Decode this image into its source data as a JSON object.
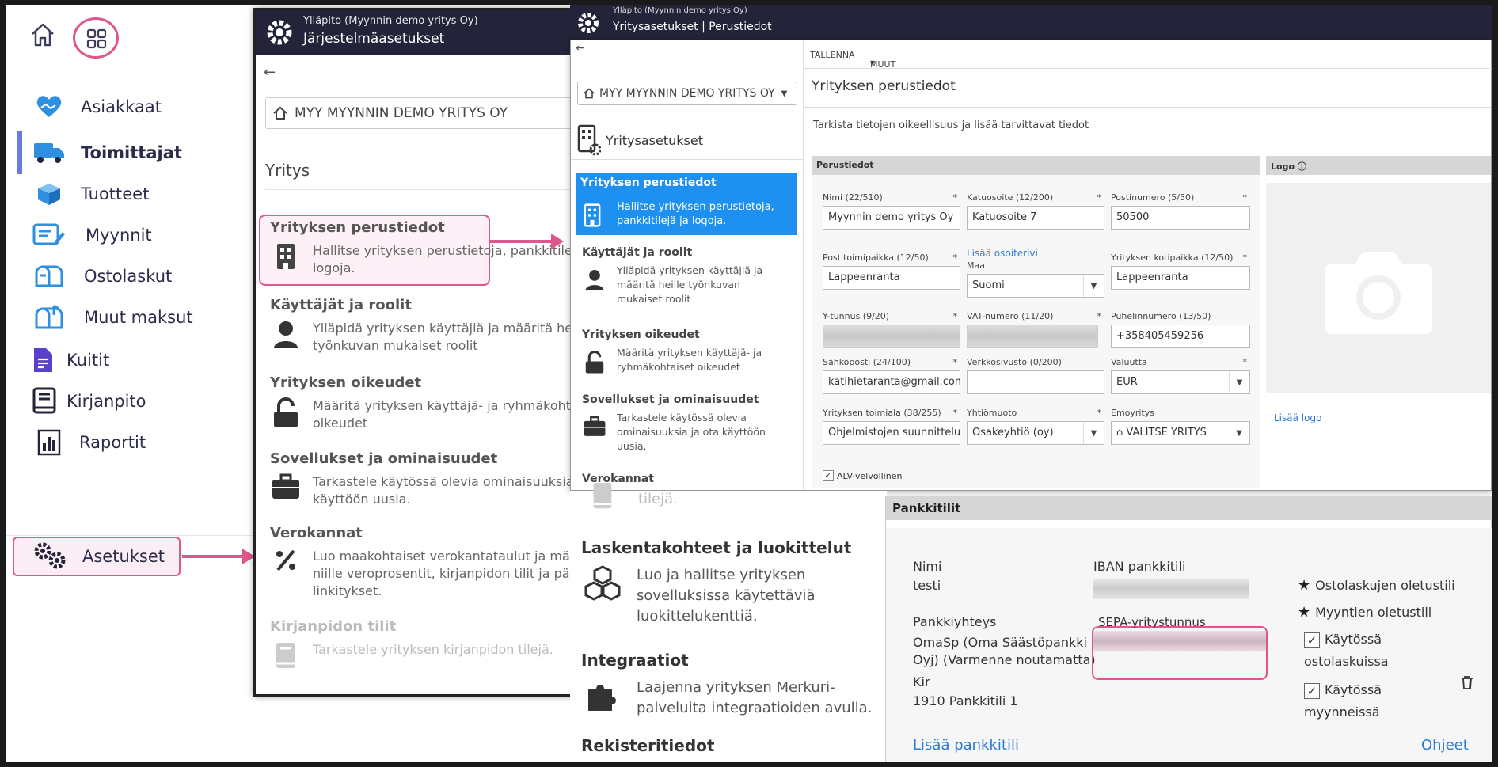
{
  "nav": {
    "items": [
      {
        "label": "Asiakkaat",
        "icon": "handshake-heart-icon"
      },
      {
        "label": "Toimittajat",
        "icon": "truck-icon"
      },
      {
        "label": "Tuotteet",
        "icon": "box-icon"
      },
      {
        "label": "Myynnit",
        "icon": "invoice-edit-icon"
      },
      {
        "label": "Ostolaskut",
        "icon": "mailbox-icon"
      },
      {
        "label": "Muut maksut",
        "icon": "mailbox-out-icon"
      },
      {
        "label": "Kuitit",
        "icon": "receipt-icon"
      },
      {
        "label": "Kirjanpito",
        "icon": "book-icon"
      },
      {
        "label": "Raportit",
        "icon": "report-icon"
      }
    ],
    "settings_label": "Asetukset"
  },
  "sys": {
    "sup": "Ylläpito (Myynnin demo yritys Oy)",
    "title": "Järjestelmäasetukset",
    "company": "MYY MYYNNIN DEMO YRITYS OY",
    "section": "Yritys",
    "items": [
      {
        "title": "Yrityksen perustiedot",
        "desc1": "Hallitse yrityksen perustietoja, pankkitilejä ja",
        "desc2": "logoja."
      },
      {
        "title": "Käyttäjät ja roolit",
        "desc1": "Ylläpidä yrityksen käyttäjiä ja määritä heille",
        "desc2": "työnkuvan mukaiset roolit"
      },
      {
        "title": "Yrityksen oikeudet",
        "desc1": "Määritä yrityksen käyttäjä- ja ryhmäkohtaiset",
        "desc2": "oikeudet"
      },
      {
        "title": "Sovellukset ja ominaisuudet",
        "desc1": "Tarkastele käytössä olevia ominaisuuksia ja ota",
        "desc2": "käyttöön uusia."
      },
      {
        "title": "Verokannat",
        "desc1": "Luo maakohtaiset verokantataulut ja määritä",
        "desc2": "niille veroprosentit, kirjanpidon tilit ja päivämäärä",
        "desc3": "linkitykset."
      },
      {
        "title": "Kirjanpidon tilit",
        "desc1": "Tarkastele yrityksen kirjanpidon tilejä."
      }
    ]
  },
  "comp": {
    "sup": "Ylläpito (Myynnin demo yritys Oy)",
    "title": "Yritysasetukset | Perustiedot",
    "toolbar": {
      "save": "TALLENNA",
      "more": "MUUT"
    },
    "company": "MYY MYYNNIN DEMO YRITYS OY",
    "heading": "Yritysasetukset",
    "active": {
      "title": "Yrityksen perustiedot",
      "desc1": "Hallitse yrityksen perustietoja,",
      "desc2": "pankkitilejä ja logoja."
    },
    "list": [
      {
        "title": "Käyttäjät ja roolit",
        "desc1": "Ylläpidä yrityksen käyttäjiä ja",
        "desc2": "määritä heille työnkuvan",
        "desc3": "mukaiset roolit"
      },
      {
        "title": "Yrityksen oikeudet",
        "desc1": "Määritä yrityksen käyttäjä- ja",
        "desc2": "ryhmäkohtaiset oikeudet"
      },
      {
        "title": "Sovellukset ja ominaisuudet",
        "desc1": "Tarkastele käytössä olevia",
        "desc2": "ominaisuuksia ja ota käyttöön",
        "desc3": "uusia."
      },
      {
        "title": "Verokannat"
      }
    ],
    "page_title": "Yrityksen perustiedot",
    "subtitle": "Tarkista tietojen oikeellisuus ja lisää tarvittavat tiedot",
    "perus_header": "Perustiedot",
    "logo_header": "Logo",
    "add_logo": "Lisää logo",
    "add_address": "Lisää osoiterivi",
    "vat_label": "ALV-velvollinen",
    "fields": {
      "nimi": {
        "label": "Nimi (22/510)",
        "value": "Myynnin demo yritys Oy"
      },
      "katu": {
        "label": "Katuosoite (12/200)",
        "value": "Katuosoite 7"
      },
      "posti": {
        "label": "Postinumero (5/50)",
        "value": "50500"
      },
      "ptp": {
        "label": "Postitoimipaikka (12/50)",
        "value": "Lappeenranta"
      },
      "maa": {
        "label": "Maa",
        "value": "Suomi"
      },
      "koti": {
        "label": "Yrityksen kotipaikka (12/50)",
        "value": "Lappeenranta"
      },
      "ytun": {
        "label": "Y-tunnus (9/20)",
        "value": ""
      },
      "vat": {
        "label": "VAT-numero (11/20)",
        "value": ""
      },
      "puh": {
        "label": "Puhelinnumero (13/50)",
        "value": "+358405459256"
      },
      "email": {
        "label": "Sähköposti (24/100)",
        "value": "katihietaranta@gmail.com"
      },
      "web": {
        "label": "Verkkosivusto (0/200)",
        "value": ""
      },
      "val": {
        "label": "Valuutta",
        "value": "EUR"
      },
      "ala": {
        "label": "Yrityksen toimiala (38/255)",
        "value": "Ohjelmistojen suunnittelu"
      },
      "muoto": {
        "label": "Yhtiömuoto",
        "value": "Osakeyhtiö (oy)"
      },
      "emo": {
        "label": "Emoyritys",
        "value": "VALITSE YRITYS"
      }
    }
  },
  "lower": {
    "ghost": "tilejä.",
    "items": [
      {
        "title": "Laskentakohteet ja luokittelut",
        "desc1": "Luo ja hallitse yrityksen",
        "desc2": "sovelluksissa käytettäviä",
        "desc3": "luokittelukenttiä."
      },
      {
        "title": "Integraatiot",
        "desc1": "Laajenna yrityksen Merkuri-",
        "desc2": "palveluita integraatioiden avulla."
      },
      {
        "title": "Rekisteritiedot"
      }
    ]
  },
  "bank": {
    "header": "Pankkitilit",
    "nimi_label": "Nimi",
    "nimi_value": "testi",
    "iban_label": "IBAN pankkitili",
    "pankki_label": "Pankkiyhteys",
    "pankki_value1": "OmaSp (Oma Säästöpankki",
    "pankki_value2": "Oyj) (Varmenne noutamatta)",
    "sepa_label": "SEPA-yritystunnus",
    "kir_label": "Kir",
    "kir_value": "1910 Pankkitili 1",
    "default_purchase": "Ostolaskujen oletustili",
    "default_sales": "Myyntien oletustili",
    "use_purchase1": "Käytössä",
    "use_purchase2": "ostolaskuissa",
    "use_sales1": "Käytössä",
    "use_sales2": "myynneissä",
    "add_account": "Lisää pankkitili",
    "help": "Ohjeet"
  }
}
